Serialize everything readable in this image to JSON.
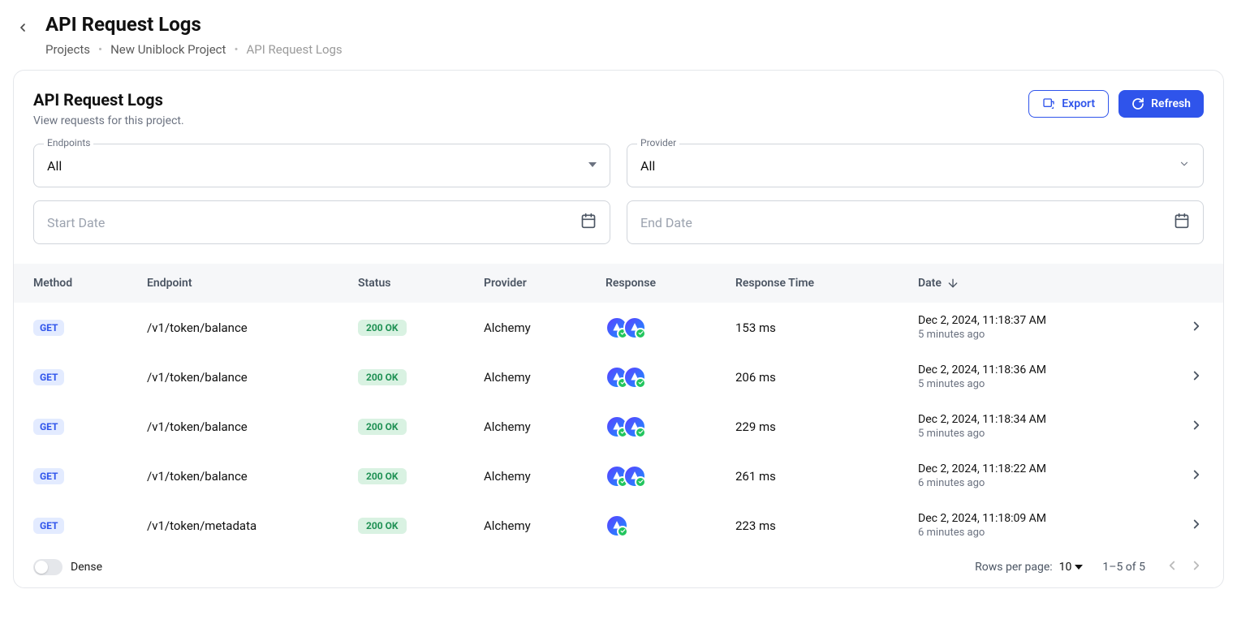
{
  "header": {
    "title": "API Request Logs",
    "breadcrumbs": [
      "Projects",
      "New Uniblock Project",
      "API Request Logs"
    ]
  },
  "panel": {
    "title": "API Request Logs",
    "subtitle": "View requests for this project.",
    "export_label": "Export",
    "refresh_label": "Refresh"
  },
  "filters": {
    "endpoints_label": "Endpoints",
    "endpoints_value": "All",
    "provider_label": "Provider",
    "provider_value": "All",
    "start_placeholder": "Start Date",
    "end_placeholder": "End Date"
  },
  "columns": {
    "method": "Method",
    "endpoint": "Endpoint",
    "status": "Status",
    "provider": "Provider",
    "response": "Response",
    "response_time": "Response Time",
    "date": "Date"
  },
  "rows": [
    {
      "method": "GET",
      "endpoint": "/v1/token/balance",
      "status": "200 OK",
      "provider": "Alchemy",
      "icons": 2,
      "time": "153 ms",
      "date": "Dec 2, 2024, 11:18:37 AM",
      "ago": "5 minutes ago"
    },
    {
      "method": "GET",
      "endpoint": "/v1/token/balance",
      "status": "200 OK",
      "provider": "Alchemy",
      "icons": 2,
      "time": "206 ms",
      "date": "Dec 2, 2024, 11:18:36 AM",
      "ago": "5 minutes ago"
    },
    {
      "method": "GET",
      "endpoint": "/v1/token/balance",
      "status": "200 OK",
      "provider": "Alchemy",
      "icons": 2,
      "time": "229 ms",
      "date": "Dec 2, 2024, 11:18:34 AM",
      "ago": "5 minutes ago"
    },
    {
      "method": "GET",
      "endpoint": "/v1/token/balance",
      "status": "200 OK",
      "provider": "Alchemy",
      "icons": 2,
      "time": "261 ms",
      "date": "Dec 2, 2024, 11:18:22 AM",
      "ago": "6 minutes ago"
    },
    {
      "method": "GET",
      "endpoint": "/v1/token/metadata",
      "status": "200 OK",
      "provider": "Alchemy",
      "icons": 1,
      "time": "223 ms",
      "date": "Dec 2, 2024, 11:18:09 AM",
      "ago": "6 minutes ago"
    }
  ],
  "footer": {
    "dense_label": "Dense",
    "rpp_label": "Rows per page:",
    "rpp_value": "10",
    "range": "1–5 of 5"
  }
}
